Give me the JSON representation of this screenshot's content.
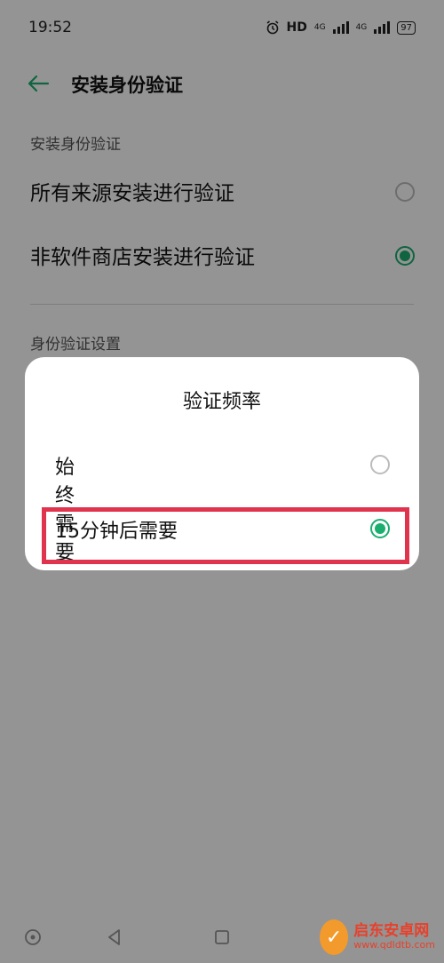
{
  "status_bar": {
    "time": "19:52",
    "hd_label": "HD",
    "net1": "4G",
    "net2": "4G",
    "battery": "97"
  },
  "app_bar": {
    "title": "安装身份验证"
  },
  "section1": {
    "label": "安装身份验证",
    "options": [
      {
        "label": "所有来源安装进行验证",
        "checked": false
      },
      {
        "label": "非软件商店安装进行验证",
        "checked": true
      }
    ]
  },
  "section2": {
    "label": "身份验证设置"
  },
  "dialog": {
    "title": "验证频率",
    "options": [
      {
        "label": "始终需要",
        "checked": false
      },
      {
        "label": "15分钟后需要",
        "checked": true
      }
    ]
  },
  "watermark": {
    "name": "启东安卓网",
    "url": "www.qdldtb.com"
  },
  "colors": {
    "accent": "#1aaf6e",
    "highlight": "#e0334e"
  }
}
